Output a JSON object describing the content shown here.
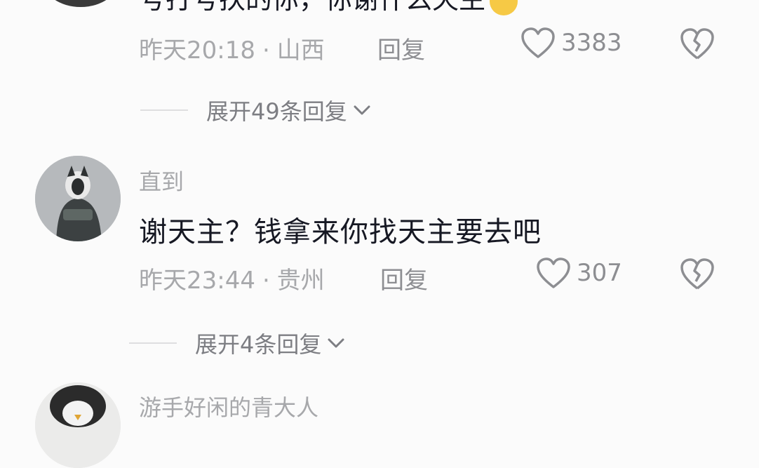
{
  "comments": [
    {
      "partial_text": "号打号扶的你，你谢什么天主",
      "time": "昨天20:18",
      "location": "山西",
      "reply_label": "回复",
      "likes": "3383",
      "expand_label": "展开49条回复"
    },
    {
      "nickname": "直到",
      "text": "谢天主？钱拿来你找天主要去吧",
      "time": "昨天23:44",
      "location": "贵州",
      "reply_label": "回复",
      "likes": "307",
      "expand_label": "展开4条回复"
    },
    {
      "nickname": "游手好闲的青大人"
    }
  ],
  "separator": "·",
  "icons": {
    "like": "heart-outline-icon",
    "dislike": "broken-heart-icon",
    "expand": "chevron-down-icon"
  },
  "colors": {
    "background": "#fbfbfb",
    "primary_text": "#161823",
    "secondary_text": "#a7a8ab"
  }
}
